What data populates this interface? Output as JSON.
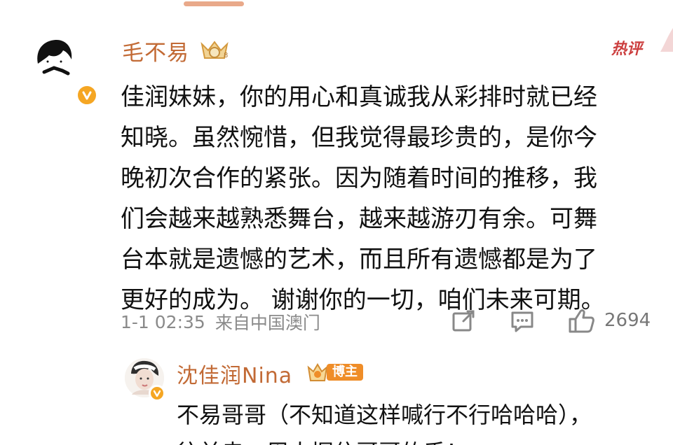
{
  "comment": {
    "username": "毛不易",
    "hot_tag": "热评",
    "lines": [
      "佳润妹妹，你的用心和真诚我从彩排时就已经",
      "知晓。虽然惋惜，但我觉得最珍贵的，是你今",
      "晚初次合作的紧张。因为随着时间的推移，我",
      "们会越来越熟悉舞台，越来越游刃有余。可舞",
      "台本就是遗憾的艺术，而且所有遗憾都是为了",
      "更好的成为。 谢谢你的一切，咱们未来可期。"
    ],
    "time": "1-1 02:35",
    "location": "来自中国澳门",
    "like_count": "2694",
    "crown_level": "8"
  },
  "reply": {
    "username": "沈佳润Nina",
    "badge": "博主",
    "lines": [
      "不易哥哥（不知道这样喊行不行哈哈哈），",
      "往前走，周太握住哥哥的手！"
    ]
  },
  "icons": {
    "share": "share-icon",
    "comment": "comment-icon",
    "like": "thumbs-up-icon",
    "verified": "verified-v-icon",
    "crown": "crown-badge-icon"
  },
  "colors": {
    "username": "#c26a35",
    "hot_tag": "#cc3f3f",
    "verified": "#f5a623",
    "meta": "#8a8a8a",
    "badge": "#ef8d28"
  }
}
